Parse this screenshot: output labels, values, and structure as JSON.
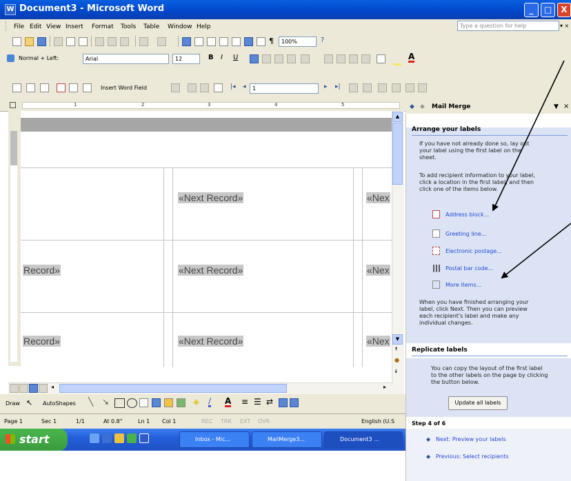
{
  "window": {
    "title": "Document3 - Microsoft Word",
    "minimize_label": "_",
    "maximize_label": "□",
    "close_label": "X"
  },
  "menubar": {
    "items": [
      "File",
      "Edit",
      "View",
      "Insert",
      "Format",
      "Tools",
      "Table",
      "Window",
      "Help"
    ],
    "ask_placeholder": "Type a question for help",
    "ask_arrow": "▾ ×"
  },
  "toolbar": {
    "zoom": "100%",
    "style": "Normal + Left:",
    "font": "Arial",
    "size": "12",
    "bold": "B",
    "italic": "I",
    "underline": "U",
    "insert_word_field": "Insert Word Field",
    "record_number": "1"
  },
  "ruler": {
    "numbers": [
      "1",
      "2",
      "3",
      "4",
      "5"
    ]
  },
  "document": {
    "row1": [
      "«Next Record»",
      "«Nex"
    ],
    "row2": [
      "Record»",
      "«Next Record»",
      "«Nex"
    ],
    "row3": [
      "Record»",
      "«Next Record»",
      "«Nex"
    ]
  },
  "drawbar": {
    "draw": "Draw",
    "autoshapes": "AutoShapes"
  },
  "statusbar": {
    "page": "Page 1",
    "sec": "Sec 1",
    "pages": "1/1",
    "at": "At 0.8\"",
    "ln": "Ln 1",
    "col": "Col 1",
    "rec": "REC",
    "trk": "TRK",
    "ext": "EXT",
    "ovr": "OVR",
    "language": "English (U.S"
  },
  "taskbar": {
    "start": "start",
    "buttons": [
      "Inbox - Mic...",
      "MailMerge3...",
      "Document3 ..."
    ]
  },
  "pane": {
    "title": "Mail Merge",
    "arrange_heading": "Arrange your labels",
    "arrange_text": [
      "If you have not already done so, lay out",
      "your label using the first label on the",
      "sheet."
    ],
    "add_text": [
      "To add recipient information to your label,",
      "click a location in the first label, and then",
      "click one of the items below."
    ],
    "links": [
      "Address block...",
      "Greeting line...",
      "Electronic postage...",
      "Postal bar code...",
      "More items..."
    ],
    "finished_text": [
      "When you have finished arranging your",
      "label, click Next. Then you can preview",
      "each recipient's label and make any",
      "individual changes."
    ],
    "replicate_heading": "Replicate labels",
    "replicate_text": [
      "You can copy the layout of the first label",
      "to the other labels on the page by clicking",
      "the button below."
    ],
    "update_button": "Update all labels",
    "step": "Step 4 of 6",
    "next_link": "Next: Preview your labels",
    "prev_link": "Previous: Select recipients"
  },
  "colors": {
    "titlebar": "#0046c8",
    "link": "#2348d9",
    "merge_field_bg": "#c8c8c8",
    "taskbar": "#245edb",
    "start": "#3a9b3c",
    "annotation_arrow": "#000000"
  }
}
